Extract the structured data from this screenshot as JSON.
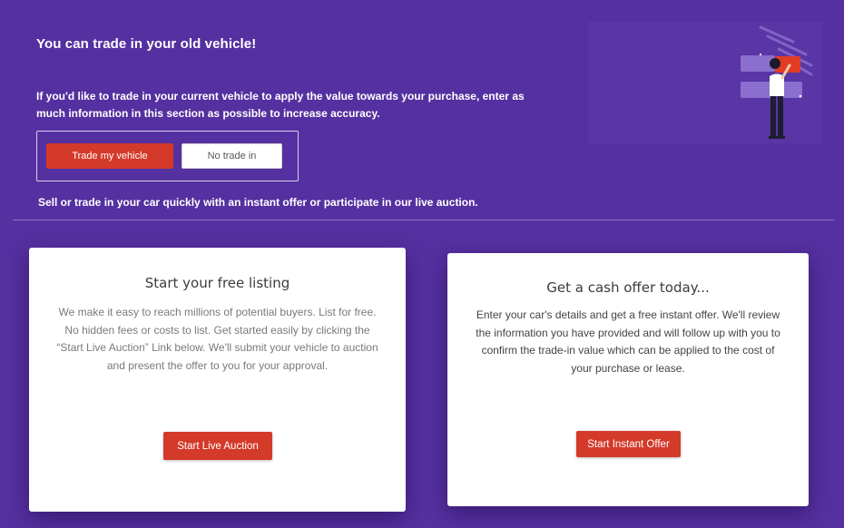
{
  "trade_section": {
    "headline": "You can trade in your old vehicle!",
    "intro": "If you'd like to trade in your current vehicle to apply the value towards your purchase, enter as much information in this section as possible to increase accuracy.",
    "trade_button": "Trade my vehicle",
    "no_trade_button": "No trade in",
    "sell_line": "Sell or trade in your car quickly with an instant offer or participate in our live auction."
  },
  "listing_card": {
    "title": "Start your free listing",
    "body": "We make it easy to reach millions of potential buyers. List for free. No hidden fees or costs to list. Get started easily by clicking the “Start Live Auction” Link below. We'll submit your vehicle to auction and present the offer to you for your approval.",
    "button": "Start Live Auction"
  },
  "offer_card": {
    "title": "Get a cash offer today...",
    "body": "Enter your car's details and get a free instant offer. We'll review the information you have provided and will follow up with you to confirm the trade-in value which can be applied to the cost of your purchase or lease.",
    "button": "Start Instant Offer"
  },
  "colors": {
    "background": "#5530a0",
    "accent_red": "#d43a2a",
    "card": "#ffffff"
  },
  "illustration": {
    "icon": "person-holding-card-illustration"
  }
}
